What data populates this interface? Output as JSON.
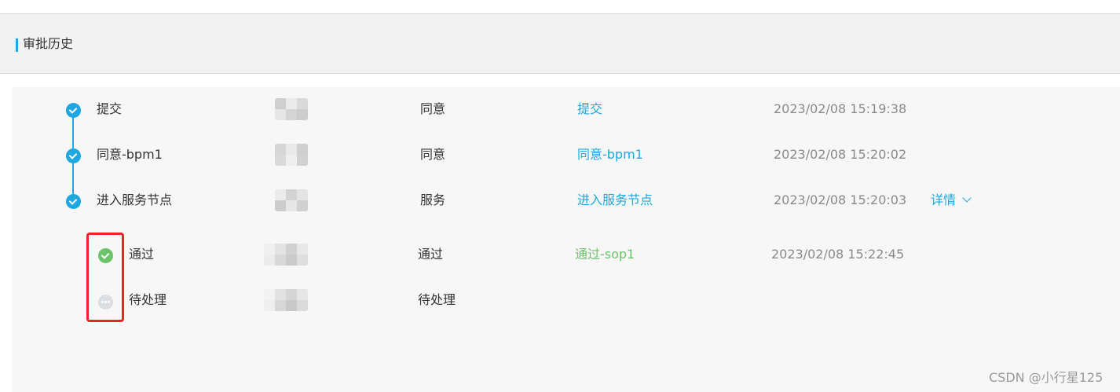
{
  "section": {
    "title": "审批历史"
  },
  "timeline": [
    {
      "name": "提交",
      "type": "同意",
      "link": "提交",
      "time": "2023/02/08 15:19:38",
      "status": "done"
    },
    {
      "name": "同意-bpm1",
      "type": "同意",
      "link": "同意-bpm1",
      "time": "2023/02/08 15:20:02",
      "status": "done"
    },
    {
      "name": "进入服务节点",
      "type": "服务",
      "link": "进入服务节点",
      "time": "2023/02/08 15:20:03",
      "status": "done",
      "detail": "详情"
    }
  ],
  "subtimeline": [
    {
      "name": "通过",
      "type": "通过",
      "link": "通过-sop1",
      "time": "2023/02/08 15:22:45",
      "status": "approved"
    },
    {
      "name": "待处理",
      "type": "待处理",
      "status": "pending"
    }
  ],
  "icons": {
    "done": "check-circle-icon",
    "approved": "check-circle-icon",
    "pending": "more-circle-icon",
    "detail": "chevron-down-icon"
  },
  "colors": {
    "accent": "#1ea7e1",
    "approved": "#6cc36c",
    "pending": "#dcdee3",
    "time": "#8a8a8a",
    "highlight": "#e8262a"
  },
  "watermark": "CSDN @小行星125"
}
